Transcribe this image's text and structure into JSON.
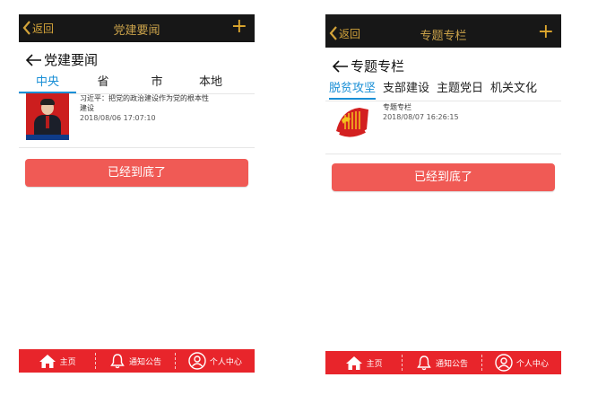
{
  "left": {
    "header": {
      "back_label": "返回",
      "title": "党建要闻",
      "plus_label": "+"
    },
    "heading": "党建要闻",
    "tabs": [
      "中央",
      "省",
      "市",
      "本地"
    ],
    "active_tab": 0,
    "item": {
      "title": "习近平：把党的政治建设作为党的根本性建设",
      "date": "2018/08/06 17:07:10"
    },
    "end_button": "已经到底了"
  },
  "right": {
    "header": {
      "back_label": "返回",
      "title": "专题专栏",
      "plus_label": "+"
    },
    "heading": "专题专栏",
    "tabs": [
      "脱贫攻坚",
      "支部建设",
      "主题党日",
      "机关文化"
    ],
    "active_tab": 0,
    "item": {
      "title": "专题专栏",
      "date": "2018/08/07 16:26:15"
    },
    "end_button": "已经到底了"
  },
  "bottom_nav": {
    "home": "主页",
    "notice": "通知公告",
    "profile": "个人中心"
  },
  "colors": {
    "header_bg": "#171717",
    "header_text": "#c9a14a",
    "accent_blue": "#1a8fd6",
    "button_red": "#f05a55",
    "nav_red": "#e8252b"
  },
  "icons": [
    "back-chevron-icon",
    "plus-icon",
    "back-arrow-icon",
    "home-icon",
    "bell-icon",
    "user-circle-icon",
    "party-emblem-icon"
  ]
}
